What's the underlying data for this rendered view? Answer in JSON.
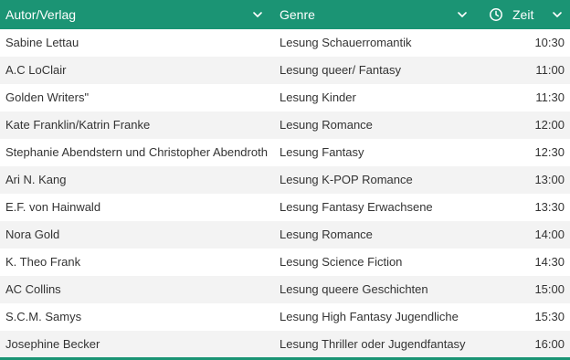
{
  "header": {
    "author_label": "Autor/Verlag",
    "genre_label": "Genre",
    "time_label": "Zeit"
  },
  "icons": {
    "sort": "chevron-down-icon",
    "time": "clock-icon"
  },
  "colors": {
    "header_bg": "#1b9474",
    "header_text": "#ffffff",
    "row_alt": "#f3f3f3",
    "row_text": "#333333"
  },
  "rows": [
    {
      "author": "Sabine Lettau",
      "genre": "Lesung Schauerromantik",
      "time": "10:30"
    },
    {
      "author": "A.C LoClair",
      "genre": "Lesung queer/ Fantasy",
      "time": "11:00"
    },
    {
      "author": "Golden Writers\"",
      "genre": "Lesung Kinder",
      "time": "11:30"
    },
    {
      "author": "Kate Franklin/Katrin Franke",
      "genre": "Lesung Romance",
      "time": "12:00"
    },
    {
      "author": "Stephanie Abendstern und Christopher Abendroth",
      "genre": "Lesung Fantasy",
      "time": "12:30"
    },
    {
      "author": "Ari N. Kang",
      "genre": "Lesung K-POP Romance",
      "time": "13:00"
    },
    {
      "author": "E.F. von Hainwald",
      "genre": "Lesung Fantasy Erwachsene",
      "time": "13:30"
    },
    {
      "author": "Nora Gold",
      "genre": "Lesung Romance",
      "time": "14:00"
    },
    {
      "author": "K. Theo Frank",
      "genre": "Lesung Science Fiction",
      "time": "14:30"
    },
    {
      "author": "AC Collins",
      "genre": "Lesung queere Geschichten",
      "time": "15:00"
    },
    {
      "author": "S.C.M. Samys",
      "genre": "Lesung High Fantasy Jugendliche",
      "time": "15:30"
    },
    {
      "author": "Josephine Becker",
      "genre": "Lesung Thriller oder Jugendfantasy",
      "time": "16:00"
    }
  ]
}
